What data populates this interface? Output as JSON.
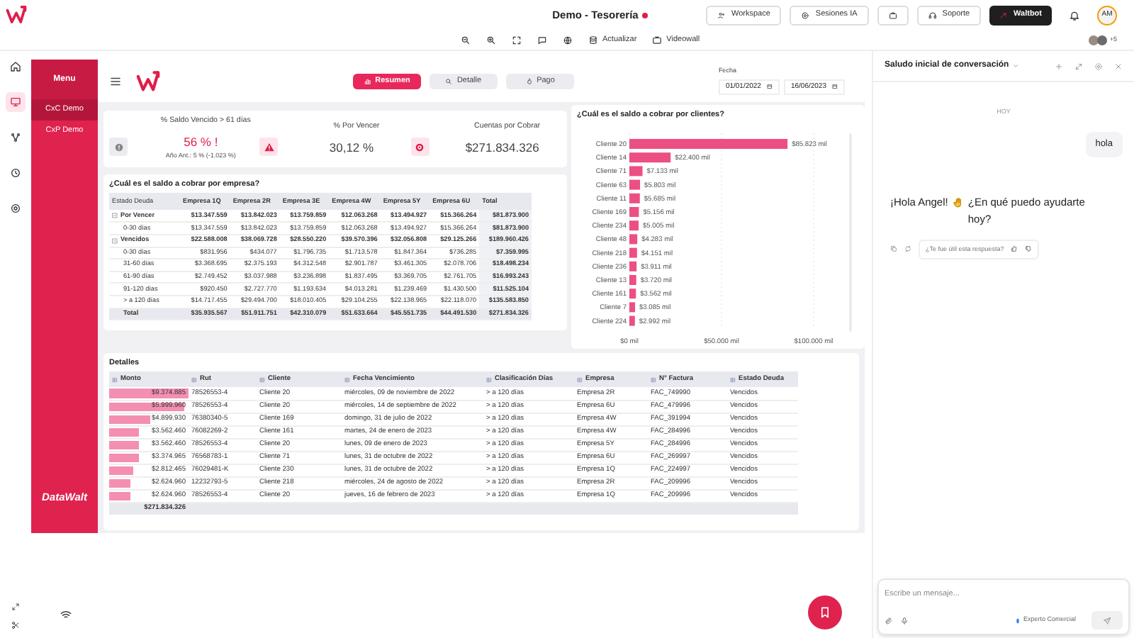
{
  "app": {
    "title": "Demo - Tesorería",
    "header_buttons": [
      {
        "kind": "workspace",
        "label": "Workspace"
      },
      {
        "kind": "sessions",
        "label": "Sesiones IA"
      },
      {
        "kind": "briefcase"
      },
      {
        "kind": "support",
        "label": "Soporte"
      },
      {
        "kind": "bot",
        "label": "Waltbot"
      }
    ],
    "avatar": "AM"
  },
  "toolbar": {
    "actions": [
      "Actualizar",
      "Videowall"
    ],
    "viewers": "+5"
  },
  "rail": [
    {
      "kind": "home",
      "selected": false
    },
    {
      "kind": "monitor",
      "selected": true
    },
    {
      "kind": "network",
      "selected": false
    },
    {
      "kind": "clock",
      "selected": false
    },
    {
      "kind": "gear",
      "selected": false
    }
  ],
  "menu": {
    "title": "Menu",
    "items": [
      {
        "label": "CxC Demo",
        "selected": true
      },
      {
        "label": "CxP Demo",
        "selected": false
      }
    ],
    "brand": "DataWalt"
  },
  "dashboard": {
    "tabs": [
      {
        "label": "Resumen",
        "kind": "summary",
        "selected": true
      },
      {
        "label": "Detalle",
        "kind": "search",
        "selected": false
      },
      {
        "label": "Pago",
        "kind": "pay",
        "selected": false
      }
    ],
    "date": {
      "label": "Fecha",
      "from": "01/01/2022",
      "to": "16/06/2023"
    }
  },
  "kpis": [
    {
      "kind": "info",
      "title": "% Saldo Vencido > 61 días",
      "value": "56 % !",
      "note": "Año Ant.: 5 % (-1.023 %)",
      "alert": true
    },
    {
      "kind": "warning",
      "title": "% Por Vencer",
      "value": "30,12 %",
      "alert": false
    },
    {
      "kind": "money",
      "title": "Cuentas por Cobrar",
      "value": "$271.834.326",
      "alert": false
    }
  ],
  "company_table": {
    "title": "¿Cuál es el saldo a cobrar por empresa?",
    "columns": [
      "Estado Deuda",
      "Empresa 1Q",
      "Empresa 2R",
      "Empresa 3E",
      "Empresa 4W",
      "Empresa 5Y",
      "Empresa 6U",
      "Total"
    ],
    "rows": [
      {
        "kind": "group",
        "expanded": true,
        "cells": [
          "Por Vencer",
          "$13.347.559",
          "$13.842.023",
          "$13.759.859",
          "$12.063.268",
          "$13.494.927",
          "$15.366.264",
          "$81.873.900"
        ]
      },
      {
        "kind": "sub",
        "cells": [
          "0-30 días",
          "$13.347.559",
          "$13.842.023",
          "$13.759.859",
          "$12.063.268",
          "$13.494.927",
          "$15.366.264",
          "$81.873.900"
        ]
      },
      {
        "kind": "group",
        "expanded": true,
        "cells": [
          "Vencidos",
          "$22.588.008",
          "$38.069.728",
          "$28.550.220",
          "$39.570.396",
          "$32.056.808",
          "$29.125.266",
          "$189.960.426"
        ]
      },
      {
        "kind": "sub",
        "cells": [
          "0-30 días",
          "$831.956",
          "$434.077",
          "$1.796.735",
          "$1.713.578",
          "$1.847.364",
          "$736.285",
          "$7.359.995"
        ]
      },
      {
        "kind": "sub",
        "cells": [
          "31-60 días",
          "$3.368.695",
          "$2.375.193",
          "$4.312.548",
          "$2.901.787",
          "$3.461.305",
          "$2.078.706",
          "$18.498.234"
        ]
      },
      {
        "kind": "sub",
        "cells": [
          "61-90 días",
          "$2.749.452",
          "$3.037.988",
          "$3.236.898",
          "$1.837.495",
          "$3.369.705",
          "$2.761.705",
          "$16.993.243"
        ]
      },
      {
        "kind": "sub",
        "cells": [
          "91-120 días",
          "$920.450",
          "$2.727.770",
          "$1.193.634",
          "$4.013.281",
          "$1.239.469",
          "$1.430.500",
          "$11.525.104"
        ]
      },
      {
        "kind": "sub",
        "cells": [
          "> a 120 días",
          "$14.717.455",
          "$29.494.700",
          "$18.010.405",
          "$29.104.255",
          "$22.138.965",
          "$22.118.070",
          "$135.583.850"
        ]
      },
      {
        "kind": "total",
        "cells": [
          "Total",
          "$35.935.567",
          "$51.911.751",
          "$42.310.079",
          "$51.633.664",
          "$45.551.735",
          "$44.491.530",
          "$271.834.326"
        ]
      }
    ]
  },
  "client_chart": {
    "title": "¿Cuál es el saldo a cobrar por clientes?",
    "chart_data": {
      "type": "bar",
      "orientation": "horizontal",
      "categories": [
        "Cliente 20",
        "Cliente 14",
        "Cliente 71",
        "Cliente 63",
        "Cliente 11",
        "Cliente 169",
        "Cliente 234",
        "Cliente 48",
        "Cliente 218",
        "Cliente 236",
        "Cliente 13",
        "Cliente 161",
        "Cliente 7",
        "Cliente 224"
      ],
      "series": [
        {
          "color": "#ec4f82",
          "values": [
            85823,
            22400,
            7133,
            5803,
            5685,
            5156,
            5005,
            4283,
            4151,
            3911,
            3720,
            3562,
            3085,
            2992
          ]
        }
      ],
      "value_labels": [
        "$85.823 mil",
        "$22.400 mil",
        "$7.133 mil",
        "$5.803 mil",
        "$5.685 mil",
        "$5.156 mil",
        "$5.005 mil",
        "$4.283 mil",
        "$4.151 mil",
        "$3.911 mil",
        "$3.720 mil",
        "$3.562 mil",
        "$3.085 mil",
        "$2.992 mil"
      ],
      "xlim": [
        0,
        100000
      ],
      "xticks": [
        {
          "value": 0,
          "label": "$0 mil"
        },
        {
          "value": 50000,
          "label": "$50.000 mil"
        },
        {
          "value": 100000,
          "label": "$100.000 mil"
        }
      ]
    }
  },
  "details": {
    "title": "Detalles",
    "columns": [
      "Monto",
      "Rut",
      "Cliente",
      "Fecha Vencimiento",
      "Clasificación Días",
      "Empresa",
      "N° Factura",
      "Estado Deuda"
    ],
    "rows": [
      {
        "level": 1,
        "cells": [
          "$9.374.885",
          "78526553-4",
          "Cliente 20",
          "miércoles, 09 de noviembre de 2022",
          "> a 120 días",
          "Empresa 2R",
          "FAC_749990",
          "Vencidos"
        ]
      },
      {
        "level": 0.95,
        "cells": [
          "$5.999.960",
          "78526553-4",
          "Cliente 20",
          "miércoles, 14 de septiembre de 2022",
          "> a 120 días",
          "Empresa 6U",
          "FAC_479996",
          "Vencidos"
        ]
      },
      {
        "level": 0.52,
        "cells": [
          "$4.899.930",
          "76380340-5",
          "Cliente 169",
          "domingo, 31 de julio de 2022",
          "> a 120 días",
          "Empresa 4W",
          "FAC_391994",
          "Vencidos"
        ]
      },
      {
        "level": 0.38,
        "cells": [
          "$3.562.460",
          "76082269-2",
          "Cliente 161",
          "martes, 24 de enero de 2023",
          "> a 120 días",
          "Empresa 4W",
          "FAC_284996",
          "Vencidos"
        ]
      },
      {
        "level": 0.38,
        "cells": [
          "$3.562.460",
          "78526553-4",
          "Cliente 20",
          "lunes, 09 de enero de 2023",
          "> a 120 días",
          "Empresa 5Y",
          "FAC_284996",
          "Vencidos"
        ]
      },
      {
        "level": 0.37,
        "cells": [
          "$3.374.965",
          "76568783-1",
          "Cliente 71",
          "lunes, 31 de octubre de 2022",
          "> a 120 días",
          "Empresa 6U",
          "FAC_269997",
          "Vencidos"
        ]
      },
      {
        "level": 0.3,
        "cells": [
          "$2.812.465",
          "76029481-K",
          "Cliente 230",
          "lunes, 31 de octubre de 2022",
          "> a 120 días",
          "Empresa 1Q",
          "FAC_224997",
          "Vencidos"
        ]
      },
      {
        "level": 0.27,
        "cells": [
          "$2.624.960",
          "12232793-5",
          "Cliente 218",
          "miércoles, 24 de agosto de 2022",
          "> a 120 días",
          "Empresa 2R",
          "FAC_209996",
          "Vencidos"
        ]
      },
      {
        "level": 0.27,
        "cells": [
          "$2.624.960",
          "78526553-4",
          "Cliente 20",
          "jueves, 16 de febrero de 2023",
          "> a 120 días",
          "Empresa 1Q",
          "FAC_209996",
          "Vencidos"
        ]
      }
    ],
    "total": "$271.834.326"
  },
  "chat": {
    "title": "Saludo inicial de conversación",
    "day": "HOY",
    "messages": [
      {
        "kind": "user",
        "text": "hola"
      },
      {
        "kind": "bot",
        "text_before": "¡Hola Angel!",
        "text_after": "¿En qué puedo ayudarte hoy?",
        "feedback": "¿Te fue útil esta respuesta?"
      }
    ],
    "input": {
      "placeholder": "Escribe un mensaje..."
    },
    "mode": "Experto Comercial"
  }
}
